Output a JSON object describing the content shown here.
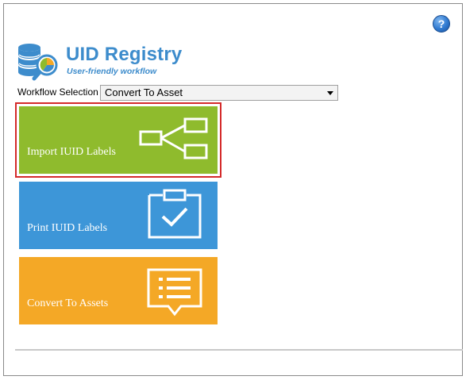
{
  "header": {
    "title": "UID Registry",
    "subtitle": "User-friendly workflow",
    "help_icon": "question-icon",
    "help_label": "?"
  },
  "workflow": {
    "label": "Workflow Selection",
    "selected": "Convert To Asset"
  },
  "tiles": [
    {
      "label": "Import IUID Labels",
      "icon": "hierarchy-icon",
      "color": "#8fbb2d",
      "selected": true
    },
    {
      "label": "Print IUID Labels",
      "icon": "clipboard-check-icon",
      "color": "#3d96d8",
      "selected": false
    },
    {
      "label": "Convert To Assets",
      "icon": "list-bubble-icon",
      "color": "#f4a826",
      "selected": false
    }
  ],
  "colors": {
    "accent": "#3d8ccc",
    "selection_border": "#d42a2a"
  }
}
